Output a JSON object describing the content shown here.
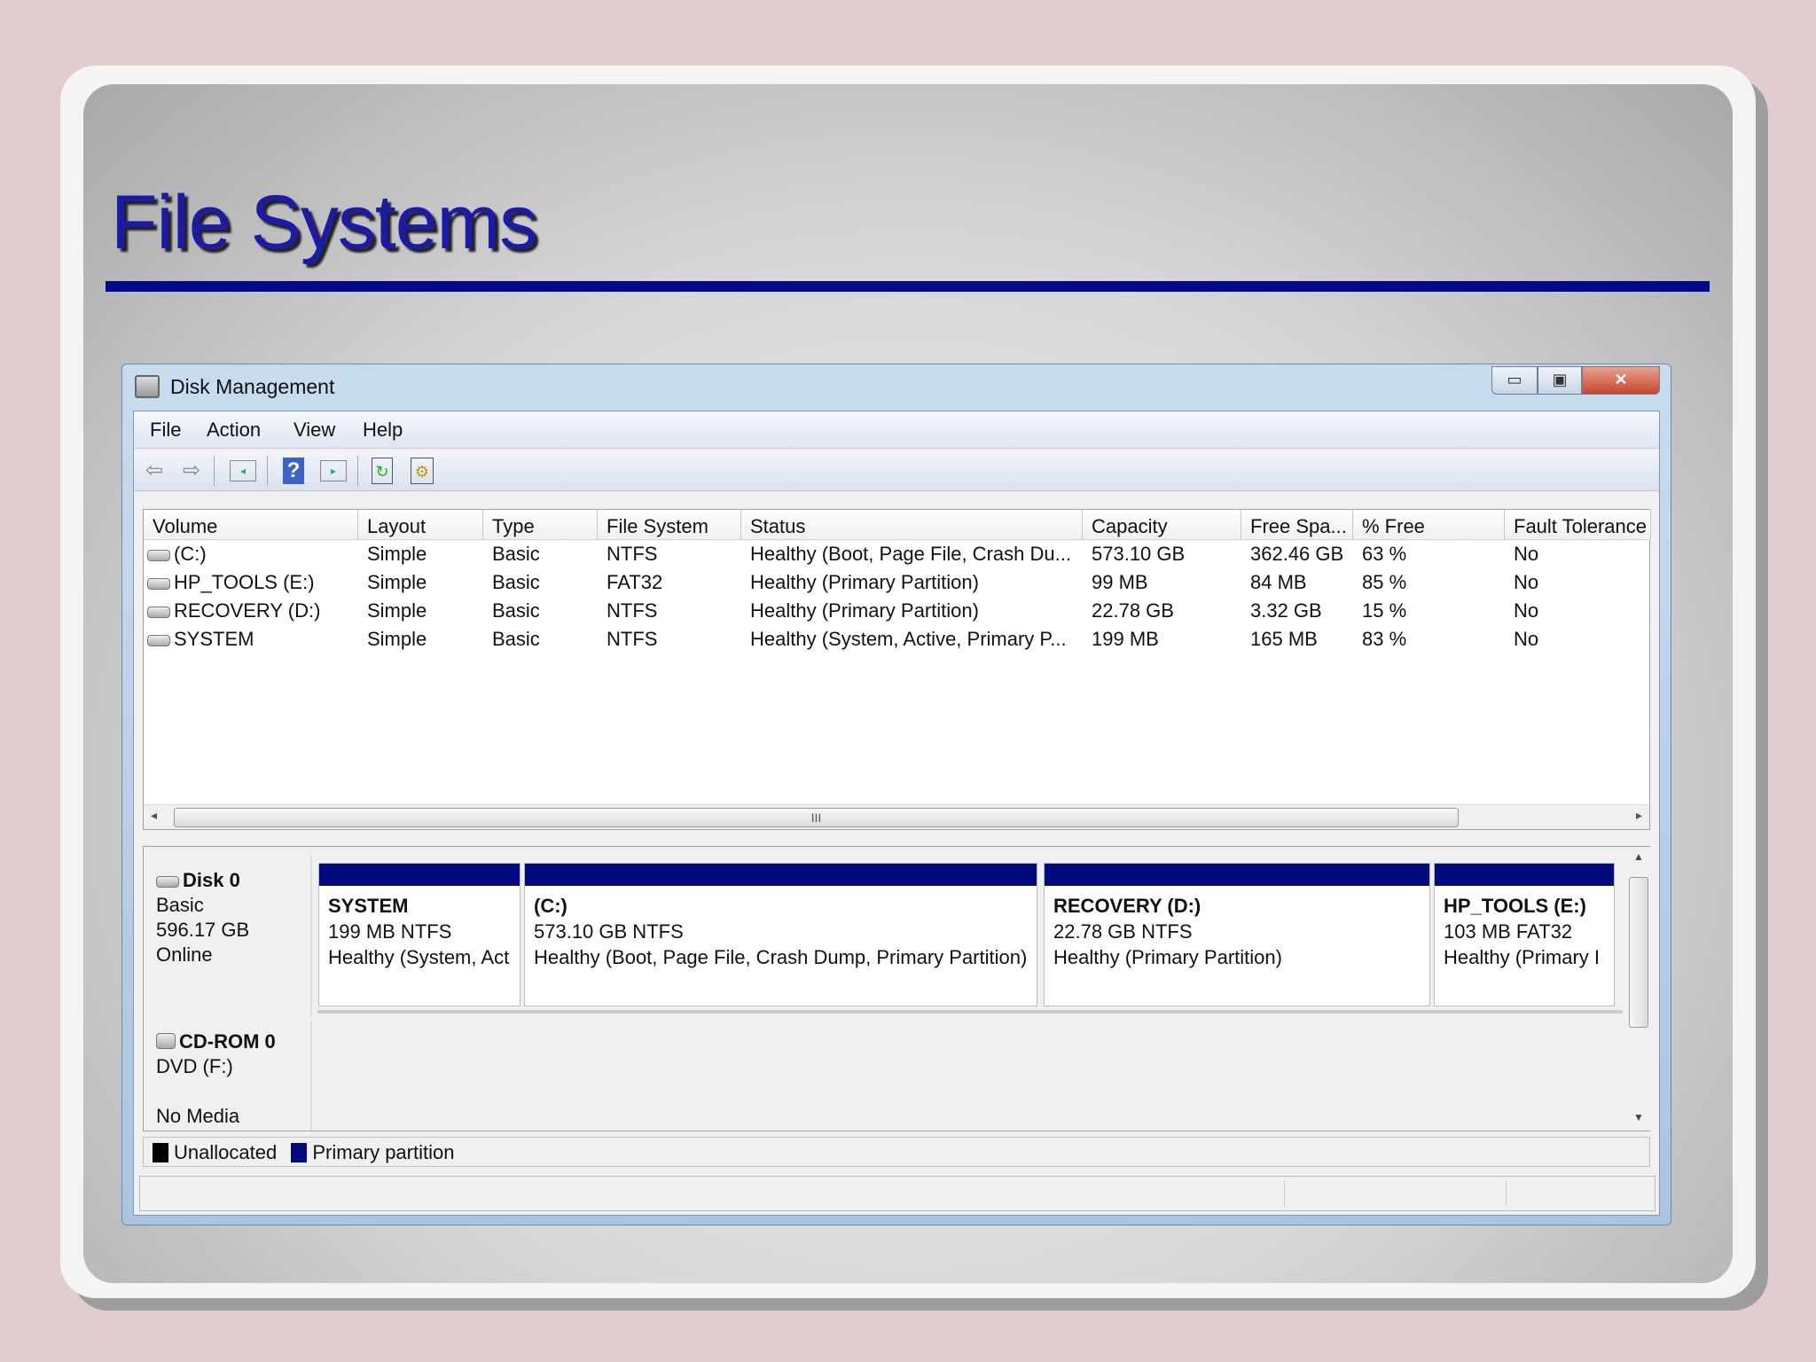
{
  "slide": {
    "title": "File Systems"
  },
  "window": {
    "title": "Disk Management",
    "minimize": "▭",
    "maximize": "▣",
    "close": "✕"
  },
  "menu": [
    "File",
    "Action",
    "View",
    "Help"
  ],
  "toolbar": {
    "icons": [
      "back-arrow-icon",
      "forward-arrow-icon",
      "show-hide-console-tree-icon",
      "help-icon",
      "show-hide-action-pane-icon",
      "refresh-icon",
      "properties-icon"
    ]
  },
  "volumes": {
    "columns": [
      "Volume",
      "Layout",
      "Type",
      "File System",
      "Status",
      "Capacity",
      "Free Spa...",
      "% Free",
      "Fault Tolerance"
    ],
    "rows": [
      [
        "(C:)",
        "Simple",
        "Basic",
        "NTFS",
        "Healthy (Boot, Page File, Crash Du...",
        "573.10 GB",
        "362.46 GB",
        "63 %",
        "No"
      ],
      [
        "HP_TOOLS (E:)",
        "Simple",
        "Basic",
        "FAT32",
        "Healthy (Primary Partition)",
        "99 MB",
        "84 MB",
        "85 %",
        "No"
      ],
      [
        "RECOVERY (D:)",
        "Simple",
        "Basic",
        "NTFS",
        "Healthy (Primary Partition)",
        "22.78 GB",
        "3.32 GB",
        "15 %",
        "No"
      ],
      [
        "SYSTEM",
        "Simple",
        "Basic",
        "NTFS",
        "Healthy (System, Active, Primary P...",
        "199 MB",
        "165 MB",
        "83 %",
        "No"
      ]
    ],
    "scroll_grip": "III"
  },
  "disks": {
    "disk0": {
      "name": "Disk 0",
      "type": "Basic",
      "size": "596.17 GB",
      "state": "Online",
      "partitions": [
        {
          "name": "SYSTEM",
          "size": "199 MB NTFS",
          "status": "Healthy (System, Act"
        },
        {
          "name": " (C:)",
          "size": "573.10 GB NTFS",
          "status": "Healthy (Boot, Page File, Crash Dump, Primary Partition)"
        },
        {
          "name": "RECOVERY  (D:)",
          "size": "22.78 GB NTFS",
          "status": "Healthy (Primary Partition)"
        },
        {
          "name": "HP_TOOLS  (E:)",
          "size": "103 MB FAT32",
          "status": "Healthy (Primary I"
        }
      ]
    },
    "cdrom0": {
      "name": "CD-ROM 0",
      "type": "DVD (F:)",
      "state": "No Media"
    }
  },
  "legend": [
    {
      "label": "Unallocated",
      "color": "#000000"
    },
    {
      "label": "Primary partition",
      "color": "#020a80"
    }
  ],
  "colors": {
    "accent": "#020a8c",
    "title": "#1b1ba8"
  }
}
